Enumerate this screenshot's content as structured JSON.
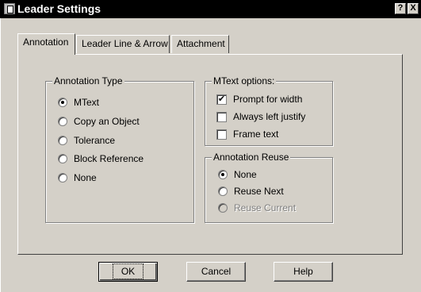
{
  "window": {
    "title": "Leader Settings",
    "help_button": "?",
    "close_button": "X"
  },
  "tabs": [
    {
      "label": "Annotation",
      "active": true
    },
    {
      "label": "Leader Line & Arrow",
      "active": false
    },
    {
      "label": "Attachment",
      "active": false
    }
  ],
  "annotation_type": {
    "label": "Annotation Type",
    "options": [
      {
        "label": "MText",
        "checked": true
      },
      {
        "label": "Copy an Object",
        "checked": false
      },
      {
        "label": "Tolerance",
        "checked": false
      },
      {
        "label": "Block Reference",
        "checked": false
      },
      {
        "label": "None",
        "checked": false
      }
    ]
  },
  "mtext_options": {
    "label": "MText options:",
    "options": [
      {
        "label": "Prompt for width",
        "checked": true
      },
      {
        "label": "Always left justify",
        "checked": false
      },
      {
        "label": "Frame text",
        "checked": false
      }
    ]
  },
  "annotation_reuse": {
    "label": "Annotation Reuse",
    "options": [
      {
        "label": "None",
        "checked": true,
        "enabled": true
      },
      {
        "label": "Reuse Next",
        "checked": false,
        "enabled": true
      },
      {
        "label": "Reuse Current",
        "checked": false,
        "enabled": false
      }
    ]
  },
  "buttons": {
    "ok": "OK",
    "cancel": "Cancel",
    "help": "Help"
  }
}
